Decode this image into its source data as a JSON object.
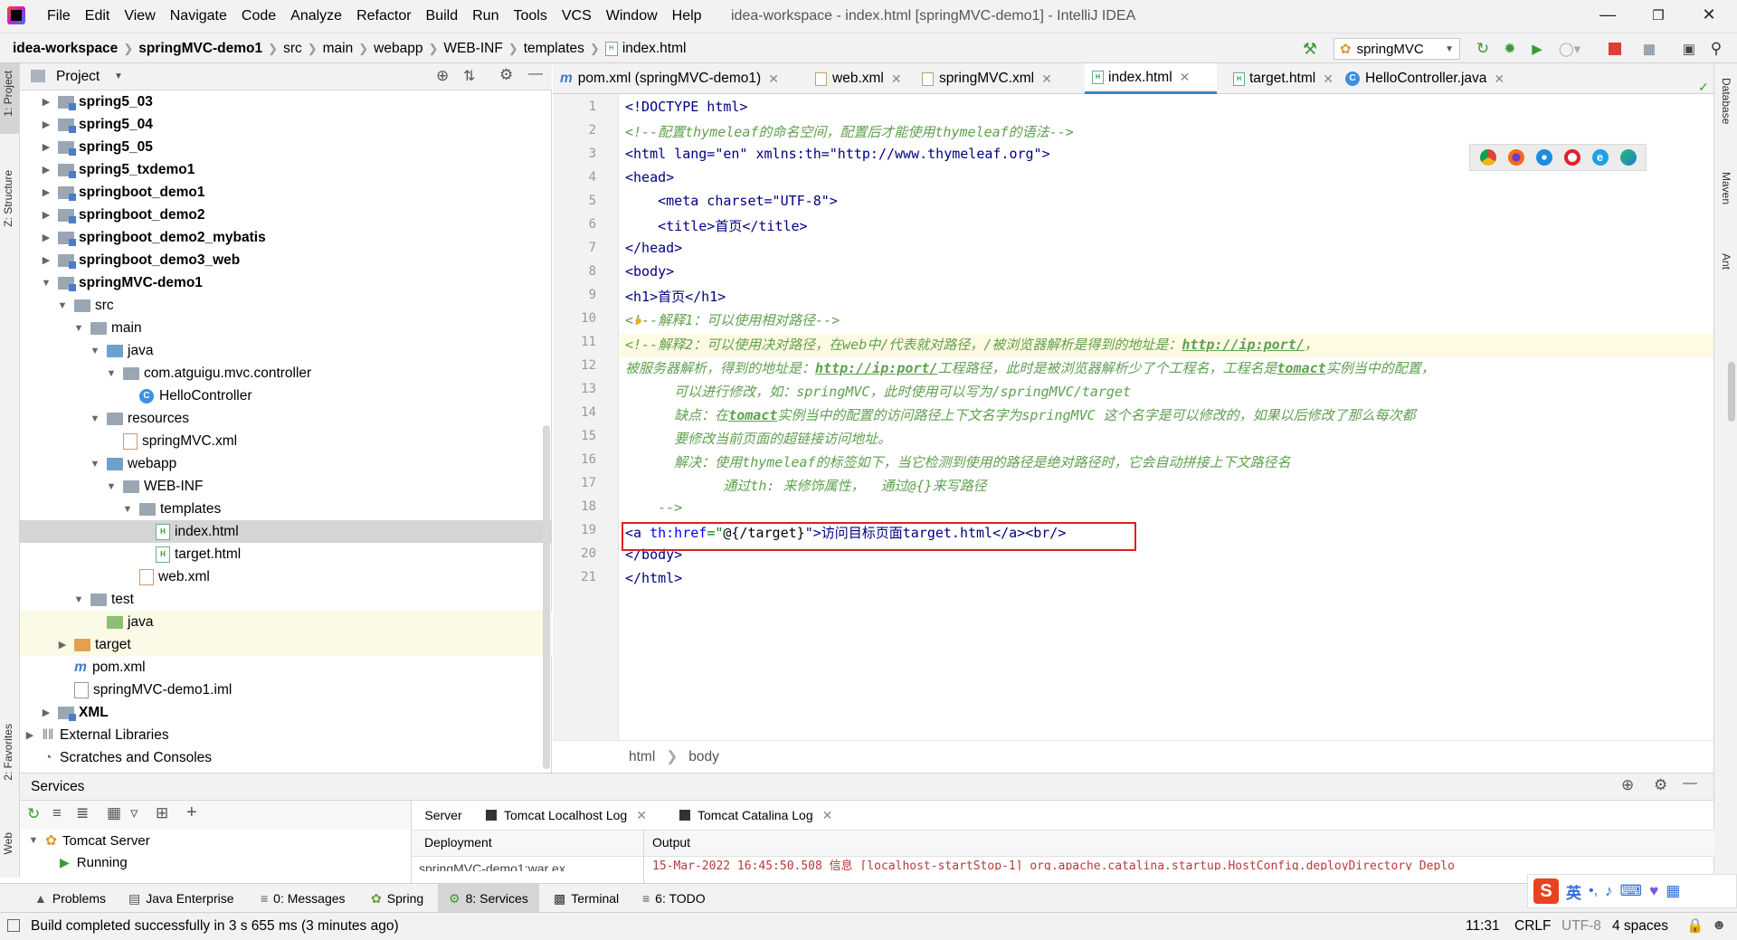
{
  "menubar": {
    "items": [
      "File",
      "Edit",
      "View",
      "Navigate",
      "Code",
      "Analyze",
      "Refactor",
      "Build",
      "Run",
      "Tools",
      "VCS",
      "Window",
      "Help"
    ],
    "window_title": "idea-workspace - index.html [springMVC-demo1] - IntelliJ IDEA"
  },
  "navbar": {
    "crumbs": [
      "idea-workspace",
      "springMVC-demo1",
      "src",
      "main",
      "webapp",
      "WEB-INF",
      "templates",
      "index.html"
    ],
    "run_config": "springMVC"
  },
  "left_stripe": {
    "project": "1: Project",
    "structure": "Z: Structure",
    "favorites": "2: Favorites",
    "web": "Web"
  },
  "right_stripe": {
    "database": "Database",
    "maven": "Maven",
    "ant": "Ant"
  },
  "project_panel": {
    "title": "Project",
    "tree": [
      {
        "label": "spring5_03",
        "bold": true
      },
      {
        "label": "spring5_04",
        "bold": true
      },
      {
        "label": "spring5_05",
        "bold": true
      },
      {
        "label": "spring5_txdemo1",
        "bold": true
      },
      {
        "label": "springboot_demo1",
        "bold": true
      },
      {
        "label": "springboot_demo2",
        "bold": true
      },
      {
        "label": "springboot_demo2_mybatis",
        "bold": true
      },
      {
        "label": "springboot_demo3_web",
        "bold": true
      },
      {
        "label": "springMVC-demo1",
        "bold": true
      },
      {
        "label": "src"
      },
      {
        "label": "main"
      },
      {
        "label": "java"
      },
      {
        "label": "com.atguigu.mvc.controller"
      },
      {
        "label": "HelloController"
      },
      {
        "label": "resources"
      },
      {
        "label": "springMVC.xml"
      },
      {
        "label": "webapp"
      },
      {
        "label": "WEB-INF"
      },
      {
        "label": "templates"
      },
      {
        "label": "index.html"
      },
      {
        "label": "target.html"
      },
      {
        "label": "web.xml"
      },
      {
        "label": "test"
      },
      {
        "label": "java"
      },
      {
        "label": "target"
      },
      {
        "label": "pom.xml"
      },
      {
        "label": "springMVC-demo1.iml"
      },
      {
        "label": "XML",
        "bold": true
      },
      {
        "label": "External Libraries"
      },
      {
        "label": "Scratches and Consoles"
      }
    ]
  },
  "editor_tabs": [
    {
      "label": "pom.xml (springMVC-demo1)"
    },
    {
      "label": "web.xml"
    },
    {
      "label": "springMVC.xml"
    },
    {
      "label": "index.html",
      "active": true
    },
    {
      "label": "target.html"
    },
    {
      "label": "HelloController.java"
    }
  ],
  "editor": {
    "line_numbers": [
      "1",
      "2",
      "3",
      "4",
      "5",
      "6",
      "7",
      "8",
      "9",
      "10",
      "11",
      "12",
      "13",
      "14",
      "15",
      "16",
      "17",
      "18",
      "19",
      "20",
      "21"
    ],
    "lines": {
      "l1": "<!DOCTYPE html>",
      "l2": "<!--配置thymeleaf的命名空间，配置后才能使用thymeleaf的语法-->",
      "l3": "<html lang=\"en\" xmlns:th=\"http://www.thymeleaf.org\">",
      "l4": "<head>",
      "l5": "    <meta charset=\"UTF-8\">",
      "l6": "    <title>首页</title>",
      "l7": "</head>",
      "l8": "<body>",
      "l9": "<h1>首页</h1>",
      "l10": "<!--解释1：可以使用相对路径-->",
      "l11a": "<!--解释2：可以使用决对路径，在web中/代表就对路径，/被浏览器解析是得到的地址是：",
      "l11b": "http://ip:port/",
      "l11c": "，",
      "l12a": "被服务器解析，得到的地址是：",
      "l12b": "http://ip:port/",
      "l12c": "工程路径，此时是被浏览器解析少了个工程名，工程名是",
      "l12d": "tomact",
      "l12e": "实例当中的配置，",
      "l13": "      可以进行修改，如：springMVC，此时使用可以写为/springMVC/target",
      "l14a": "      缺点：在",
      "l14b": "tomact",
      "l14c": "实例当中的配置的访问路径上下文名字为springMVC 这个名字是可以修改的，如果以后修改了那么每次都",
      "l15": "      要修改当前页面的超链接访问地址。",
      "l16": "      解决：使用thymeleaf的标签如下，当它检测到使用的路径是绝对路径时，它会自动拼接上下文路径名",
      "l17": "            通过th: 来修饰属性，  通过@{}来写路径",
      "l18": "    -->",
      "l19a": "<a ",
      "l19b": "th:href",
      "l19c": "=\"",
      "l19d": "@{/target}",
      "l19e": "\">访问目标页面target.html</a><br/>",
      "l20": "</body>",
      "l21": "</html>"
    },
    "breadcrumb": [
      "html",
      "body"
    ]
  },
  "services": {
    "title": "Services",
    "tabs": [
      "Server",
      "Tomcat Localhost Log",
      "Tomcat Catalina Log"
    ],
    "deployment_label": "Deployment",
    "output_label": "Output",
    "tree": [
      "Tomcat Server",
      "Running"
    ],
    "deployment_item": "springMVC-demo1:war ex",
    "output_line": "15-Mar-2022 16:45:50.508 信息 [localhost-startStop-1] org.apache.catalina.startup.HostConfig.deployDirectory Deplo"
  },
  "tool_tabs": [
    {
      "label": "Problems"
    },
    {
      "label": "Java Enterprise"
    },
    {
      "label": "0: Messages"
    },
    {
      "label": "Spring"
    },
    {
      "label": "8: Services",
      "active": true
    },
    {
      "label": "Terminal"
    },
    {
      "label": "6: TODO"
    }
  ],
  "status": {
    "message": "Build completed successfully in 3 s 655 ms (3 minutes ago)",
    "position": "11:31",
    "line_sep": "CRLF",
    "encoding": "UTF-8",
    "indent": "4 spaces"
  },
  "ime": {
    "lang": "英"
  },
  "colors": {
    "accent": "#4083c9",
    "highlight_box": "#e02020",
    "comment": "#5fa04e",
    "tag": "#000080"
  }
}
